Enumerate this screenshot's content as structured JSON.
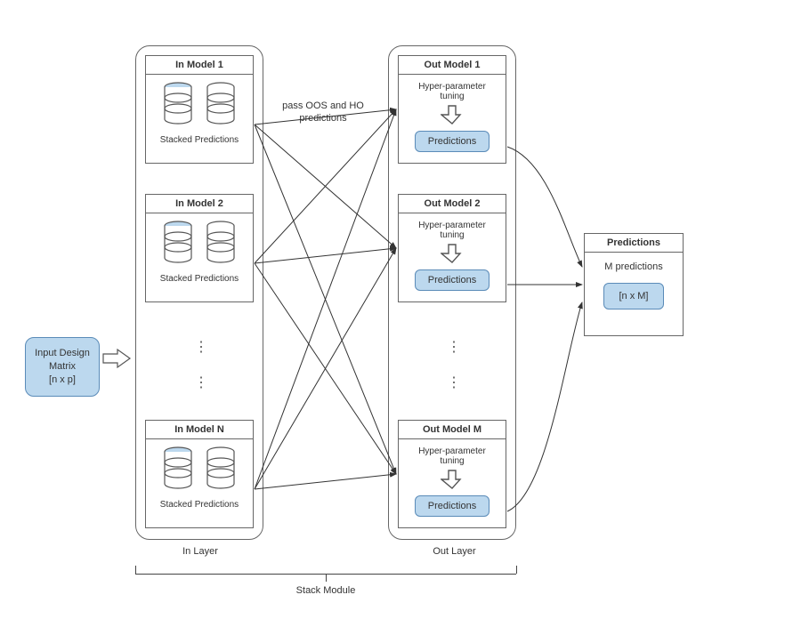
{
  "input": {
    "label": "Input Design\nMatrix\n[n x p]"
  },
  "inLayer": {
    "label": "In Layer",
    "models": [
      {
        "title": "In Model 1",
        "caption": "Stacked Predictions"
      },
      {
        "title": "In Model 2",
        "caption": "Stacked Predictions"
      },
      {
        "title": "In Model N",
        "caption": "Stacked Predictions"
      }
    ]
  },
  "passLabel": "pass OOS and HO\npredictions",
  "outLayer": {
    "label": "Out Layer",
    "models": [
      {
        "title": "Out Model 1",
        "hp": "Hyper-parameter tuning",
        "pred": "Predictions"
      },
      {
        "title": "Out Model 2",
        "hp": "Hyper-parameter tuning",
        "pred": "Predictions"
      },
      {
        "title": "Out Model M",
        "hp": "Hyper-parameter tuning",
        "pred": "Predictions"
      }
    ]
  },
  "predictions": {
    "title": "Predictions",
    "line1": "M predictions",
    "line2": "[n x M]"
  },
  "stackModule": "Stack Module"
}
